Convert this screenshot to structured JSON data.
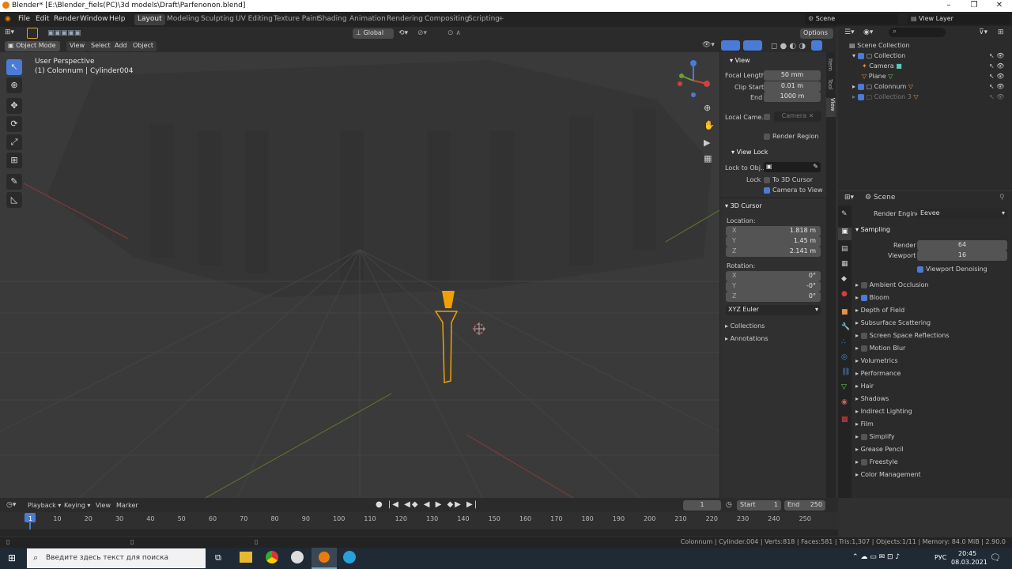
{
  "window": {
    "title": "Blender* [E:\\Blender_fiels(PC)\\3d models\\Draft\\Parfenonon.blend]"
  },
  "menu": {
    "file": "File",
    "edit": "Edit",
    "render": "Render",
    "window": "Window",
    "help": "Help"
  },
  "workspaces": [
    "Layout",
    "Modeling",
    "Sculpting",
    "UV Editing",
    "Texture Paint",
    "Shading",
    "Animation",
    "Rendering",
    "Compositing",
    "Scripting"
  ],
  "scene_field": "Scene",
  "view_layer_field": "View Layer",
  "header": {
    "transform_orientation": "Global",
    "options": "Options",
    "mode": "Object Mode",
    "view": "View",
    "select": "Select",
    "add": "Add",
    "object": "Object"
  },
  "viewport": {
    "perspective": "User Perspective",
    "object_info": "(1) Colonnum | Cylinder004"
  },
  "npanel": {
    "tabs": [
      "Item",
      "Tool",
      "View"
    ],
    "view_title": "View",
    "focal_length_label": "Focal Length",
    "focal_length": "50 mm",
    "clip_start_label": "Clip Start",
    "clip_start": "0.01 m",
    "end_label": "End",
    "end": "1000 m",
    "local_camera_label": "Local Came...",
    "local_camera": "Camera",
    "render_region": "Render Region",
    "view_lock_title": "View Lock",
    "lock_to_obj_label": "Lock to Obj...",
    "lock_label": "Lock",
    "to_3d_cursor": "To 3D Cursor",
    "camera_to_view": "Camera to View",
    "cursor_title": "3D Cursor",
    "location_label": "Location:",
    "loc_x": "1.818 m",
    "loc_y": "1.45 m",
    "loc_z": "2.141 m",
    "rotation_label": "Rotation:",
    "rot_x": "0°",
    "rot_y": "-0°",
    "rot_z": "0°",
    "euler": "XYZ Euler",
    "collections": "Collections",
    "annotations": "Annotations",
    "x": "X",
    "y": "Y",
    "z": "Z"
  },
  "outliner": {
    "root": "Scene Collection",
    "items": [
      "Collection",
      "Camera",
      "Plane",
      "Colonnum",
      "Collection 3"
    ]
  },
  "properties": {
    "scene": "Scene",
    "render_engine_label": "Render Engine",
    "render_engine": "Eevee",
    "sampling": "Sampling",
    "render_label": "Render",
    "render_samples": "64",
    "viewport_label": "Viewport",
    "viewport_samples": "16",
    "viewport_denoising": "Viewport Denoising",
    "sections": [
      "Ambient Occlusion",
      "Bloom",
      "Depth of Field",
      "Subsurface Scattering",
      "Screen Space Reflections",
      "Motion Blur",
      "Volumetrics",
      "Performance",
      "Hair",
      "Shadows",
      "Indirect Lighting",
      "Film",
      "Simplify",
      "Grease Pencil",
      "Freestyle",
      "Color Management"
    ]
  },
  "timeline": {
    "playback": "Playback",
    "keying": "Keying",
    "view": "View",
    "marker": "Marker",
    "current_frame": "1",
    "start_label": "Start",
    "start": "1",
    "end_label": "End",
    "end": "250",
    "ticks": [
      "1",
      "10",
      "20",
      "30",
      "40",
      "50",
      "60",
      "70",
      "80",
      "90",
      "100",
      "110",
      "120",
      "130",
      "140",
      "150",
      "160",
      "170",
      "180",
      "190",
      "200",
      "210",
      "220",
      "230",
      "240",
      "250"
    ]
  },
  "status": {
    "text": "Colonnum | Cylinder.004 | Verts:818 | Faces:581 | Tris:1,307 | Objects:1/11 | Memory: 84.0 MiB | 2.90.0"
  },
  "taskbar": {
    "search_placeholder": "Введите здесь текст для поиска",
    "lang": "РУС",
    "time": "20:45",
    "date": "08.03.2021"
  }
}
